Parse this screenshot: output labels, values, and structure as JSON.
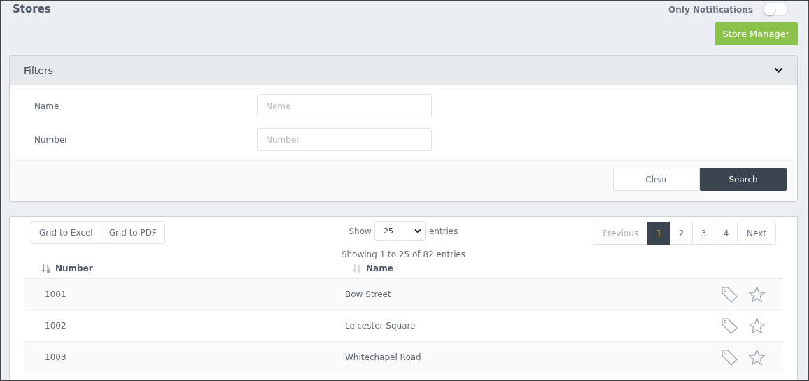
{
  "page_title": "Stores",
  "notifications_toggle": {
    "label": "Only Notifications",
    "on": false
  },
  "store_manager_button": "Store Manager",
  "filters": {
    "title": "Filters",
    "expanded": true,
    "fields": [
      {
        "label": "Name",
        "placeholder": "Name"
      },
      {
        "label": "Number",
        "placeholder": "Number"
      }
    ],
    "buttons": [
      {
        "label": "Clear",
        "kind": "secondary"
      },
      {
        "label": "Search",
        "kind": "primary"
      }
    ]
  },
  "grid": {
    "export_buttons": [
      "Grid to Excel",
      "Grid to PDF"
    ],
    "page_size": {
      "before": "Show",
      "value": "25",
      "after": "entries"
    },
    "pagination": [
      {
        "label": "Previous",
        "disabled": true,
        "selected": false
      },
      {
        "label": "1",
        "disabled": false,
        "selected": true
      },
      {
        "label": "2",
        "disabled": false,
        "selected": false
      },
      {
        "label": "3",
        "disabled": false,
        "selected": false
      },
      {
        "label": "4",
        "disabled": false,
        "selected": false
      },
      {
        "label": "Next",
        "disabled": false,
        "selected": false
      }
    ],
    "info": "Showing 1 to 25 of 82 entries",
    "columns": [
      {
        "label": "Number",
        "sorted": true
      },
      {
        "label": "Name",
        "sorted": false
      }
    ],
    "rows": [
      {
        "number": "1001",
        "name": "Bow Street",
        "favorite": false
      },
      {
        "number": "1002",
        "name": "Leicester Square",
        "favorite": false
      },
      {
        "number": "1003",
        "name": "Whitechapel Road",
        "favorite": false
      }
    ]
  }
}
